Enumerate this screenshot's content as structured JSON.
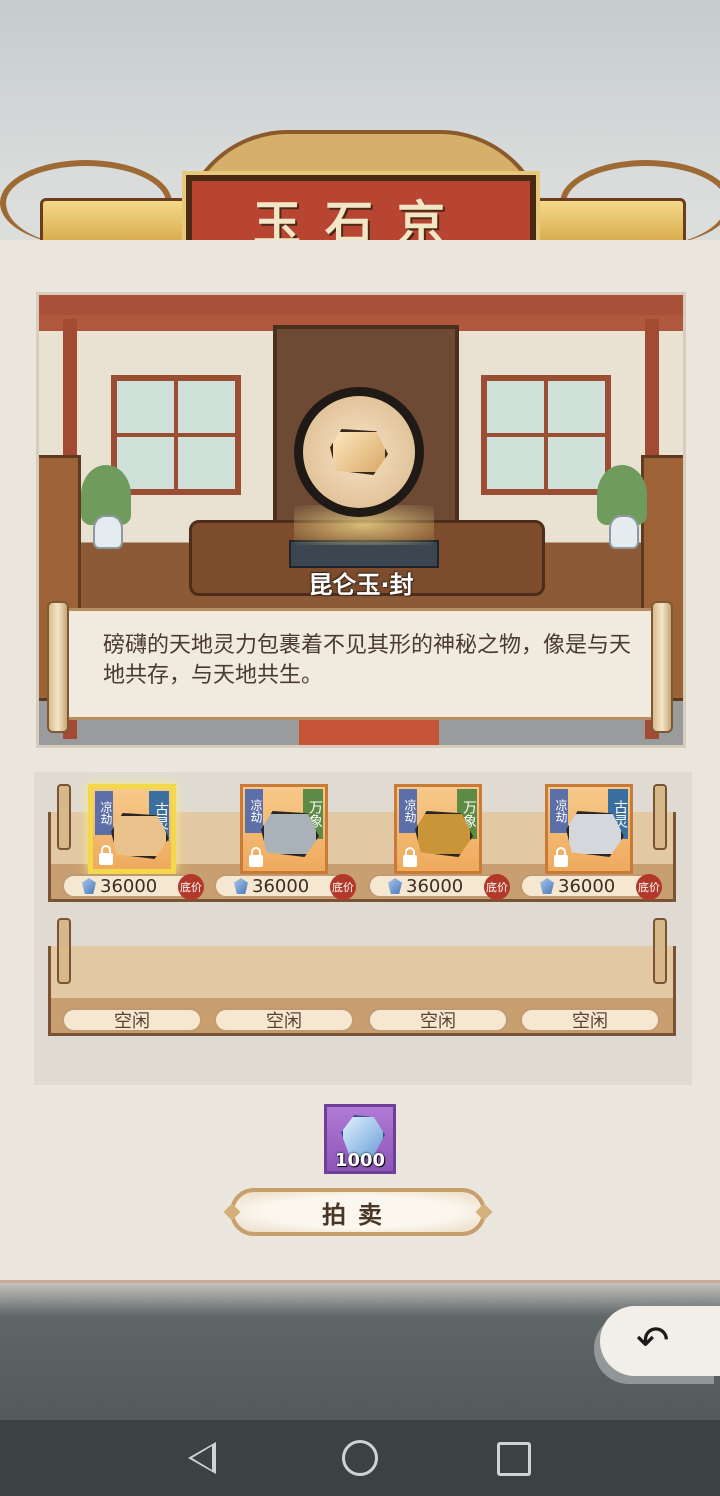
{
  "header": {
    "title": "玉石京"
  },
  "showcase": {
    "item_name": "昆仑玉·封",
    "description": "磅礴的天地灵力包裹着不见其形的神秘之物，像是与天地共存，与天地共生。"
  },
  "shelf_top": {
    "slots": [
      {
        "left_tag": "凉劫",
        "right_tag": "古灵",
        "stone_color": "#e8c28a",
        "price": "36000",
        "badge": "底价",
        "selected": true
      },
      {
        "left_tag": "凉劫",
        "right_tag": "万象",
        "stone_color": "#a9b2b8",
        "price": "36000",
        "badge": "底价",
        "selected": false
      },
      {
        "left_tag": "凉劫",
        "right_tag": "万象",
        "stone_color": "#c99538",
        "price": "36000",
        "badge": "底价",
        "selected": false
      },
      {
        "left_tag": "凉劫",
        "right_tag": "古灵",
        "stone_color": "#d4d8dc",
        "price": "36000",
        "badge": "底价",
        "selected": false
      }
    ]
  },
  "shelf_bottom": {
    "slots": [
      {
        "label": "空闲"
      },
      {
        "label": "空闲"
      },
      {
        "label": "空闲"
      },
      {
        "label": "空闲"
      }
    ]
  },
  "auction": {
    "cost": "1000",
    "button_label": "拍卖"
  },
  "back_button": {
    "icon": "return-arrow-icon",
    "glyph": "↶"
  },
  "colors": {
    "title_plaque": "#b84532",
    "slot_bg": "#eeaa5d",
    "selected_border": "#f4d84b",
    "cost_box": "#8e55b8"
  }
}
